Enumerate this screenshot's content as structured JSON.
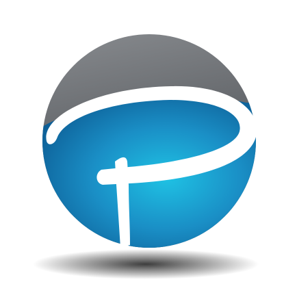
{
  "logo": {
    "icon": "p-globe-logo-icon",
    "colors": {
      "globe_blue_light": "#1fc2e4",
      "globe_blue_mid": "#1a8fc6",
      "globe_blue_dark": "#0c5a92",
      "cap_gray_light": "#8a8d91",
      "cap_gray_dark": "#3f4246",
      "letter_white": "#ffffff",
      "shadow": "#1b1b1b",
      "background": "#ffffff"
    }
  }
}
